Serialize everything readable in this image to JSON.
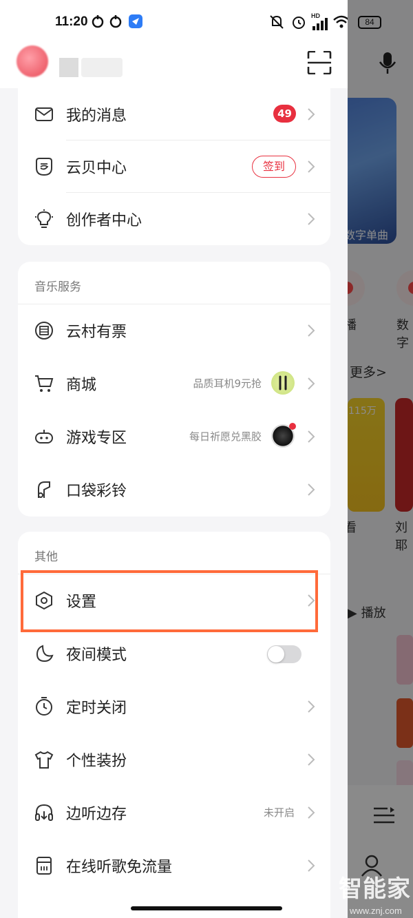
{
  "status_bar": {
    "time": "11:20",
    "signal_label": "HD",
    "battery": "84"
  },
  "background_page": {
    "banner_text": "数字单曲",
    "label_bo": "播",
    "label_shu": "数字",
    "more": "更多>",
    "card_count": "115万",
    "label_kan": "看",
    "label_liu": "刘耶",
    "play": "▶ 播放"
  },
  "drawer": {
    "section1": [
      {
        "label": "我的消息",
        "badge": "49",
        "icon": "mail-icon"
      },
      {
        "label": "云贝中心",
        "pill": "签到",
        "icon": "cloud-coin-icon"
      },
      {
        "label": "创作者中心",
        "icon": "lightbulb-icon"
      }
    ],
    "music_services": {
      "title": "音乐服务",
      "items": [
        {
          "label": "云村有票",
          "icon": "ticket-icon"
        },
        {
          "label": "商城",
          "sub": "品质耳机9元抢",
          "icon": "cart-icon"
        },
        {
          "label": "游戏专区",
          "sub": "每日祈愿兑黑胶",
          "icon": "gamepad-icon"
        },
        {
          "label": "口袋彩铃",
          "icon": "ringtone-icon"
        }
      ]
    },
    "others": {
      "title": "其他",
      "items": [
        {
          "label": "设置",
          "icon": "settings-hexagon-icon"
        },
        {
          "label": "夜间模式",
          "icon": "moon-icon",
          "toggle": false
        },
        {
          "label": "定时关闭",
          "icon": "timer-icon"
        },
        {
          "label": "个性装扮",
          "icon": "tshirt-icon"
        },
        {
          "label": "边听边存",
          "sub": "未开启",
          "icon": "headphones-download-icon"
        },
        {
          "label": "在线听歌免流量",
          "icon": "sim-card-icon"
        }
      ]
    }
  },
  "watermark": {
    "text": "智能家",
    "url": "www.znj.com"
  },
  "colors": {
    "accent_red": "#e8303f",
    "highlight_orange": "#ff6a3a"
  }
}
